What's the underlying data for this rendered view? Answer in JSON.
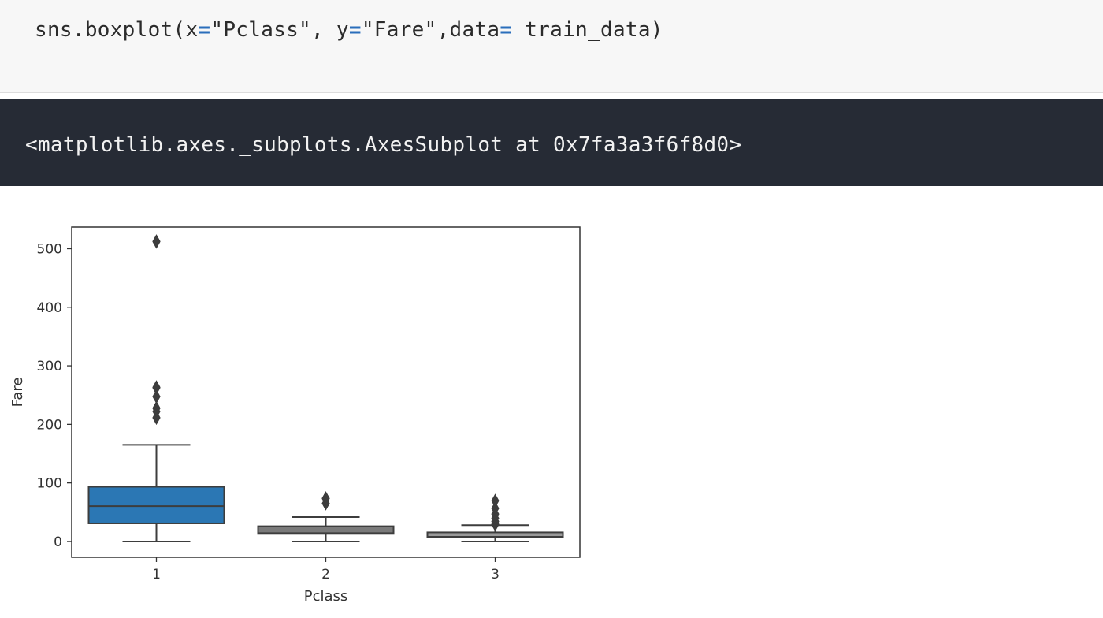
{
  "code_cell": {
    "parts": {
      "p1": "sns.boxplot(x",
      "eq1": "=",
      "p2": "\"Pclass\", y",
      "eq2": "=",
      "p3": "\"Fare\",data",
      "eq3": "=",
      "p4": " train_data)"
    }
  },
  "output_cell": {
    "text": "<matplotlib.axes._subplots.AxesSubplot at 0x7fa3a3f6f8d0>"
  },
  "chart_data": {
    "type": "boxplot",
    "title": "",
    "xlabel": "Pclass",
    "ylabel": "Fare",
    "ylim": [
      -27,
      537
    ],
    "y_ticks": [
      0,
      100,
      200,
      300,
      400,
      500
    ],
    "categories": [
      "1",
      "2",
      "3"
    ],
    "boxes": [
      {
        "category": "1",
        "color": "#2b77b4",
        "whisker_low": 0,
        "q1": 30.9,
        "median": 60.3,
        "q3": 93.5,
        "whisker_high": 164.9,
        "outliers": [
          211.3,
          211.5,
          221.8,
          227.5,
          227.5,
          227.5,
          247.5,
          247.5,
          262.4,
          263.0,
          263.0,
          263.0,
          512.3,
          512.3,
          512.3
        ]
      },
      {
        "category": "2",
        "color": "#7a7a7a",
        "whisker_low": 0,
        "q1": 13.0,
        "median": 14.25,
        "q3": 26.0,
        "whisker_high": 41.6,
        "outliers": [
          65.0,
          65.0,
          73.5,
          73.5,
          73.5,
          73.5
        ]
      },
      {
        "category": "3",
        "color": "#9a9a9a",
        "whisker_low": 0,
        "q1": 7.75,
        "median": 8.05,
        "q3": 15.5,
        "whisker_high": 27.9,
        "outliers": [
          29.1,
          31.3,
          31.4,
          34.4,
          39.7,
          46.9,
          56.5,
          69.6
        ]
      }
    ],
    "grid": false,
    "legend": "none"
  }
}
